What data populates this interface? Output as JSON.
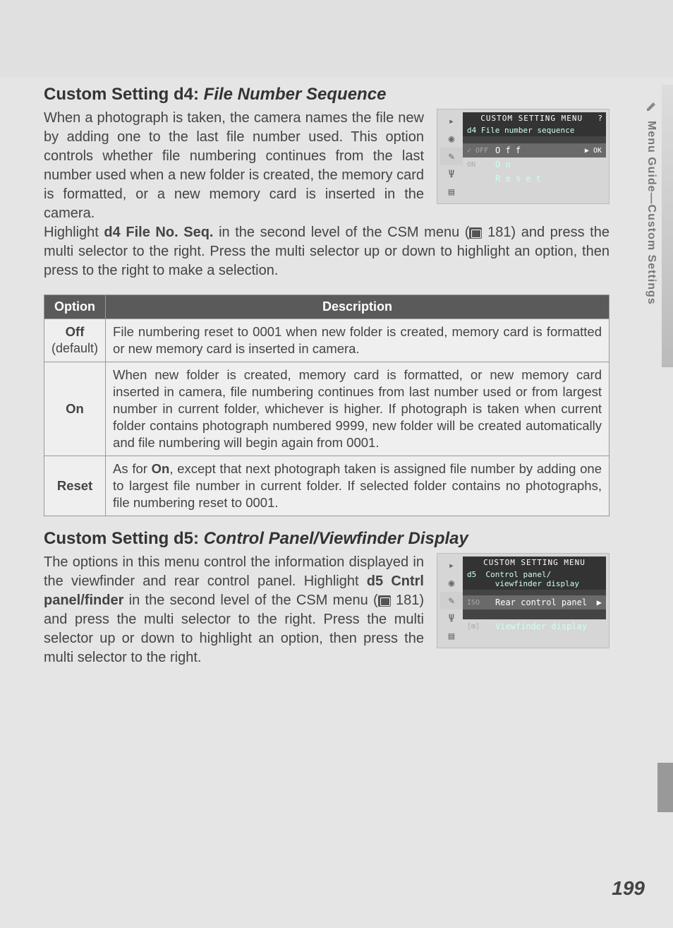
{
  "sidebar": {
    "label": "Menu Guide—Custom Settings"
  },
  "d4": {
    "heading_prefix": "Custom Setting d4: ",
    "heading_title": "File Number Sequence",
    "para1": "When a photograph is taken, the camera names the file new by adding one to the last file number used.  This option controls whether file numbering continues from the last number used when a new folder is created, the memory card is formatted, or a new memory card is inserted in the camera.",
    "para2a": "Highlight ",
    "para2b": "d4 File No. Seq.",
    "para2c": " in the second level of the CSM menu (",
    "para2d": " 181) and press the multi selector to the right.  Press the multi selector up or down to highlight an option, then press to the right to make a selection.",
    "menu": {
      "title": "CUSTOM SETTING MENU",
      "sub": "d4  File number sequence",
      "opt_off_pref": "✓ OFF",
      "opt_off": "O f f",
      "ok": "▶ OK",
      "opt_on_pref": "ON",
      "opt_on": "O n",
      "opt_reset": "R e s e t"
    }
  },
  "table": {
    "h1": "Option",
    "h2": "Description",
    "rows": [
      {
        "opt": "Off",
        "sub": "(default)",
        "desc": "File numbering reset to 0001 when new folder is created, memory card is formatted or new memory card is inserted in camera."
      },
      {
        "opt": "On",
        "sub": "",
        "desc": "When new folder is created, memory card is formatted, or new memory card inserted in camera, file numbering continues from last number used or from largest number in current folder, whichever is higher.  If photograph is taken when current folder contains photograph numbered 9999, new folder will be created automatically and file numbering will begin again from 0001."
      },
      {
        "opt": "Reset",
        "sub": "",
        "desc_a": "As for ",
        "desc_b": "On",
        "desc_c": ", except that next photograph taken is assigned file number by adding one to largest file number in current folder.  If selected folder contains no photographs, file numbering reset to 0001."
      }
    ]
  },
  "d5": {
    "heading_prefix": "Custom Setting d5: ",
    "heading_title": "Control Panel/Viewfinder Display",
    "para_a": "The options in this menu control the information displayed in the viewfinder and rear control panel.  Highlight ",
    "para_b": "d5 Cntrl panel/finder",
    "para_c": " in the second level of the CSM menu (",
    "para_d": " 181) and press the multi selector to the right.  Press the multi selector up or down to highlight an option, then press the multi selector to the right.",
    "menu": {
      "title": "CUSTOM SETTING MENU",
      "sub": "d5  Control panel/\n      viewfinder display",
      "opt1_pref": "ISO",
      "opt1": "Rear control panel",
      "opt1_arrow": "▶",
      "opt2_pref": "[⊞]",
      "opt2": "Viewfinder display"
    }
  },
  "page_number": "199"
}
